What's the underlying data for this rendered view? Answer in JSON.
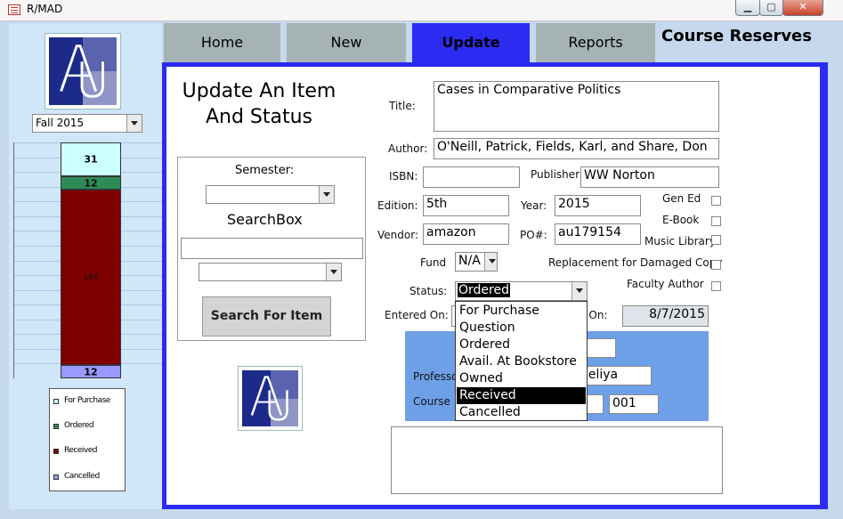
{
  "window": {
    "title": "R/MAD"
  },
  "left": {
    "semester_value": "Fall 2015",
    "chart_data": {
      "type": "bar",
      "stacked": true,
      "categories": [
        ""
      ],
      "series": [
        {
          "name": "For Purchase",
          "values": [
            31
          ],
          "color": "#ccffff"
        },
        {
          "name": "Ordered",
          "values": [
            12
          ],
          "color": "#2e8b57"
        },
        {
          "name": "Received",
          "values": [
            160
          ],
          "color": "#800000"
        },
        {
          "name": "Cancelled",
          "values": [
            12
          ],
          "color": "#9999ff"
        }
      ],
      "data_labels": [
        "31",
        "12",
        "160",
        "12"
      ],
      "legend": [
        "For Purchase",
        "Ordered",
        "Received",
        "Cancelled"
      ],
      "legend_position": "bottom",
      "grid": true
    }
  },
  "tabs": [
    {
      "label": "Home"
    },
    {
      "label": "New"
    },
    {
      "label": "Update"
    },
    {
      "label": "Reports"
    }
  ],
  "active_tab": "Update",
  "header": {
    "title": "Course Reserves"
  },
  "search": {
    "heading": "Update An Item And Status",
    "semester_label": "Semester:",
    "searchbox_label": "SearchBox",
    "button_label": "Search For Item"
  },
  "form": {
    "title_label": "Title:",
    "title_value": "Cases in Comparative Politics",
    "author_label": "Author:",
    "author_value": "O'Neill, Patrick, Fields, Karl, and Share, Don",
    "isbn_label": "ISBN:",
    "isbn_value": "",
    "publisher_label": "Publisher:",
    "publisher_value": "WW Norton",
    "edition_label": "Edition:",
    "edition_value": "5th",
    "year_label": "Year:",
    "year_value": "2015",
    "vendor_label": "Vendor:",
    "vendor_value": "amazon",
    "po_label": "PO#:",
    "po_value": "au179154",
    "gen_ed_label": "Gen Ed",
    "ebook_label": "E-Book",
    "music_label": "Music Library",
    "replacement_label": "Replacement for Damaged Copy",
    "faculty_label": "Faculty Author",
    "fund_label": "Fund",
    "fund_value": "N/A",
    "status_label": "Status:",
    "status_value": "Ordered",
    "entered_label": "Entered On:",
    "updated_label": "d On:",
    "updated_value": "8/7/2015",
    "professor_label": "Professo",
    "professor_value": "neliya",
    "course_label": "Course",
    "section_value": "001"
  },
  "status_options": [
    {
      "label": "For Purchase"
    },
    {
      "label": "Question"
    },
    {
      "label": "Ordered"
    },
    {
      "label": "Avail. At Bookstore"
    },
    {
      "label": "Owned"
    },
    {
      "label": "Received",
      "highlighted": true
    },
    {
      "label": "Cancelled"
    }
  ]
}
